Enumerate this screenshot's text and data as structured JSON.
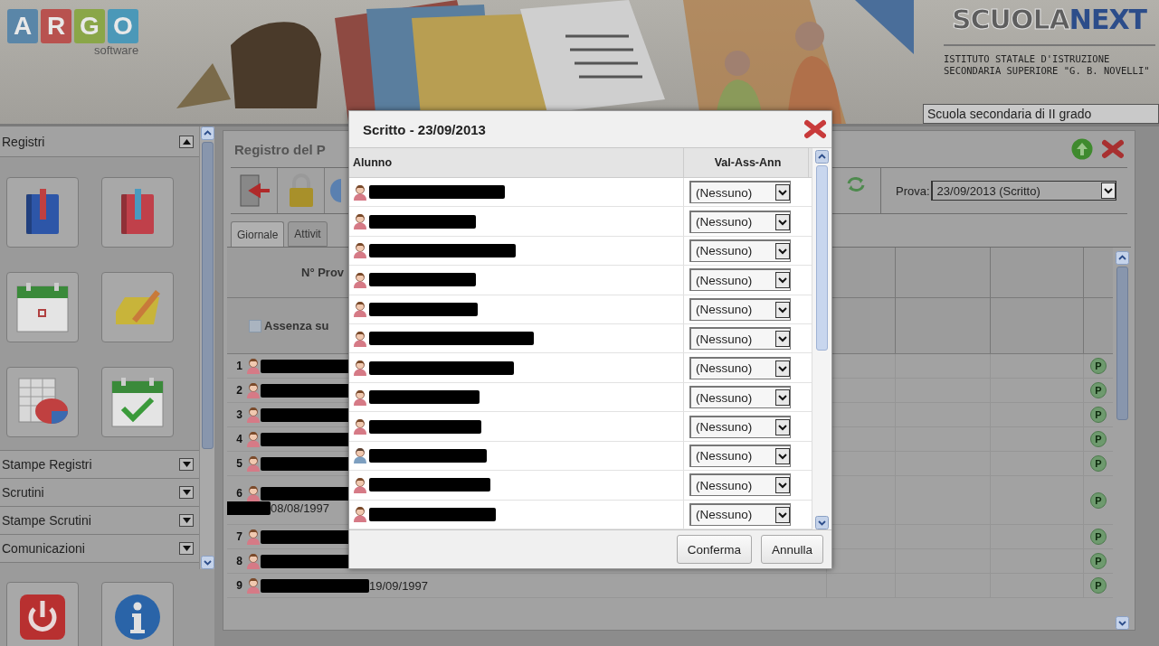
{
  "header": {
    "logo": {
      "letters": [
        {
          "char": "A",
          "color": "#5a86a8"
        },
        {
          "char": "R",
          "color": "#b8524f"
        },
        {
          "char": "G",
          "color": "#8aa648"
        },
        {
          "char": "O",
          "color": "#4b98b8"
        }
      ],
      "subtitle": "software"
    },
    "brand": {
      "part_1": "SCUOLA",
      "part_2": "NEXT"
    },
    "institute": "ISTITUTO STATALE D'ISTRUZIONE SECONDARIA SUPERIORE \"G. B. NOVELLI\"",
    "school_type": "Scuola secondaria di II grado"
  },
  "sidebar": {
    "sections": [
      {
        "label": "Registri",
        "expanded": true
      },
      {
        "label": "Stampe Registri",
        "expanded": false
      },
      {
        "label": "Scrutini",
        "expanded": false
      },
      {
        "label": "Stampe Scrutini",
        "expanded": false
      },
      {
        "label": "Comunicazioni",
        "expanded": false
      }
    ]
  },
  "main": {
    "title": "Registro del P",
    "prova_label": "Prova:",
    "prova_value": "23/09/2013 (Scritto)",
    "tabs": [
      {
        "label": "Giornale",
        "selected": true
      },
      {
        "label": "Attivit",
        "selected": false
      }
    ],
    "grid": {
      "column_1": "N° Prov",
      "absence_label": "Assenza su",
      "absence_checked": false,
      "rows": [
        {
          "number": "1",
          "kind": "female",
          "badge": "P"
        },
        {
          "number": "2",
          "kind": "female",
          "badge": "P"
        },
        {
          "number": "3",
          "kind": "female",
          "badge": "P"
        },
        {
          "number": "4",
          "kind": "female",
          "badge": "P"
        },
        {
          "number": "5",
          "kind": "female",
          "badge": "P"
        },
        {
          "number": "6",
          "kind": "female",
          "badge": "P",
          "second_line": "08/08/1997"
        },
        {
          "number": "7",
          "kind": "female",
          "badge": "P"
        },
        {
          "number": "8",
          "kind": "female",
          "badge": "P"
        },
        {
          "number": "9",
          "kind": "female",
          "badge": "P",
          "date": "19/09/1997"
        }
      ]
    }
  },
  "dialog": {
    "title": "Scritto - 23/09/2013",
    "columns": [
      "Alunno",
      "Val-Ass-Ann"
    ],
    "rows": [
      {
        "kind": "female",
        "value": "(Nessuno)"
      },
      {
        "kind": "female",
        "value": "(Nessuno)"
      },
      {
        "kind": "female",
        "value": "(Nessuno)"
      },
      {
        "kind": "female",
        "value": "(Nessuno)"
      },
      {
        "kind": "female",
        "value": "(Nessuno)"
      },
      {
        "kind": "female",
        "value": "(Nessuno)"
      },
      {
        "kind": "female",
        "value": "(Nessuno)"
      },
      {
        "kind": "female",
        "value": "(Nessuno)"
      },
      {
        "kind": "female",
        "value": "(Nessuno)"
      },
      {
        "kind": "male",
        "value": "(Nessuno)"
      },
      {
        "kind": "female",
        "value": "(Nessuno)"
      },
      {
        "kind": "female",
        "value": "(Nessuno)"
      }
    ],
    "buttons": [
      "Conferma",
      "Annulla"
    ]
  }
}
